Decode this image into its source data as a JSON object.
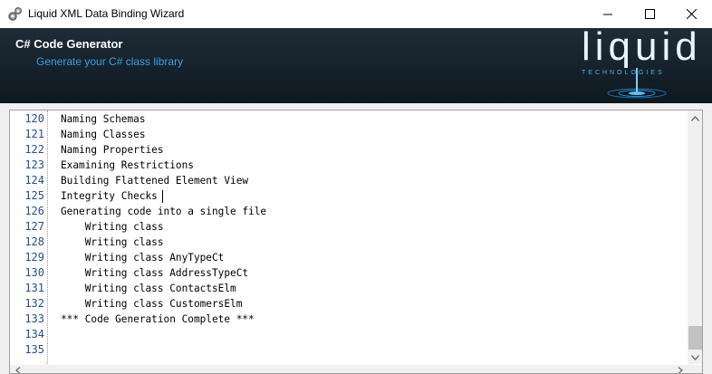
{
  "window": {
    "title": "Liquid XML Data Binding Wizard",
    "app_icon": "gears-icon",
    "controls": [
      "minimize-icon",
      "maximize-icon",
      "close-icon"
    ]
  },
  "header": {
    "title": "C# Code Generator",
    "subtitle": "Generate your C# class library",
    "logo_text": "liquid",
    "logo_tagline": "TECHNOLOGIES",
    "colors": {
      "background": "#17232d",
      "subtitle": "#3aa0e6",
      "logo_accent": "#4db2ef"
    }
  },
  "editor": {
    "line_number_color": "#2b4c8c",
    "lines": [
      {
        "no": "120",
        "text": "Naming Schemas"
      },
      {
        "no": "121",
        "text": "Naming Classes"
      },
      {
        "no": "122",
        "text": "Naming Properties"
      },
      {
        "no": "123",
        "text": "Examining Restrictions"
      },
      {
        "no": "124",
        "text": "Building Flattened Element View"
      },
      {
        "no": "125",
        "text": "Integrity Checks"
      },
      {
        "no": "126",
        "text": "Generating code into a single file"
      },
      {
        "no": "127",
        "text": "    Writing class"
      },
      {
        "no": "128",
        "text": "    Writing class"
      },
      {
        "no": "129",
        "text": "    Writing class AnyTypeCt"
      },
      {
        "no": "130",
        "text": "    Writing class AddressTypeCt"
      },
      {
        "no": "131",
        "text": "    Writing class ContactsElm"
      },
      {
        "no": "132",
        "text": "    Writing class CustomersElm"
      },
      {
        "no": "133",
        "text": "*** Code Generation Complete ***"
      },
      {
        "no": "134",
        "text": ""
      },
      {
        "no": "135",
        "text": ""
      }
    ]
  }
}
